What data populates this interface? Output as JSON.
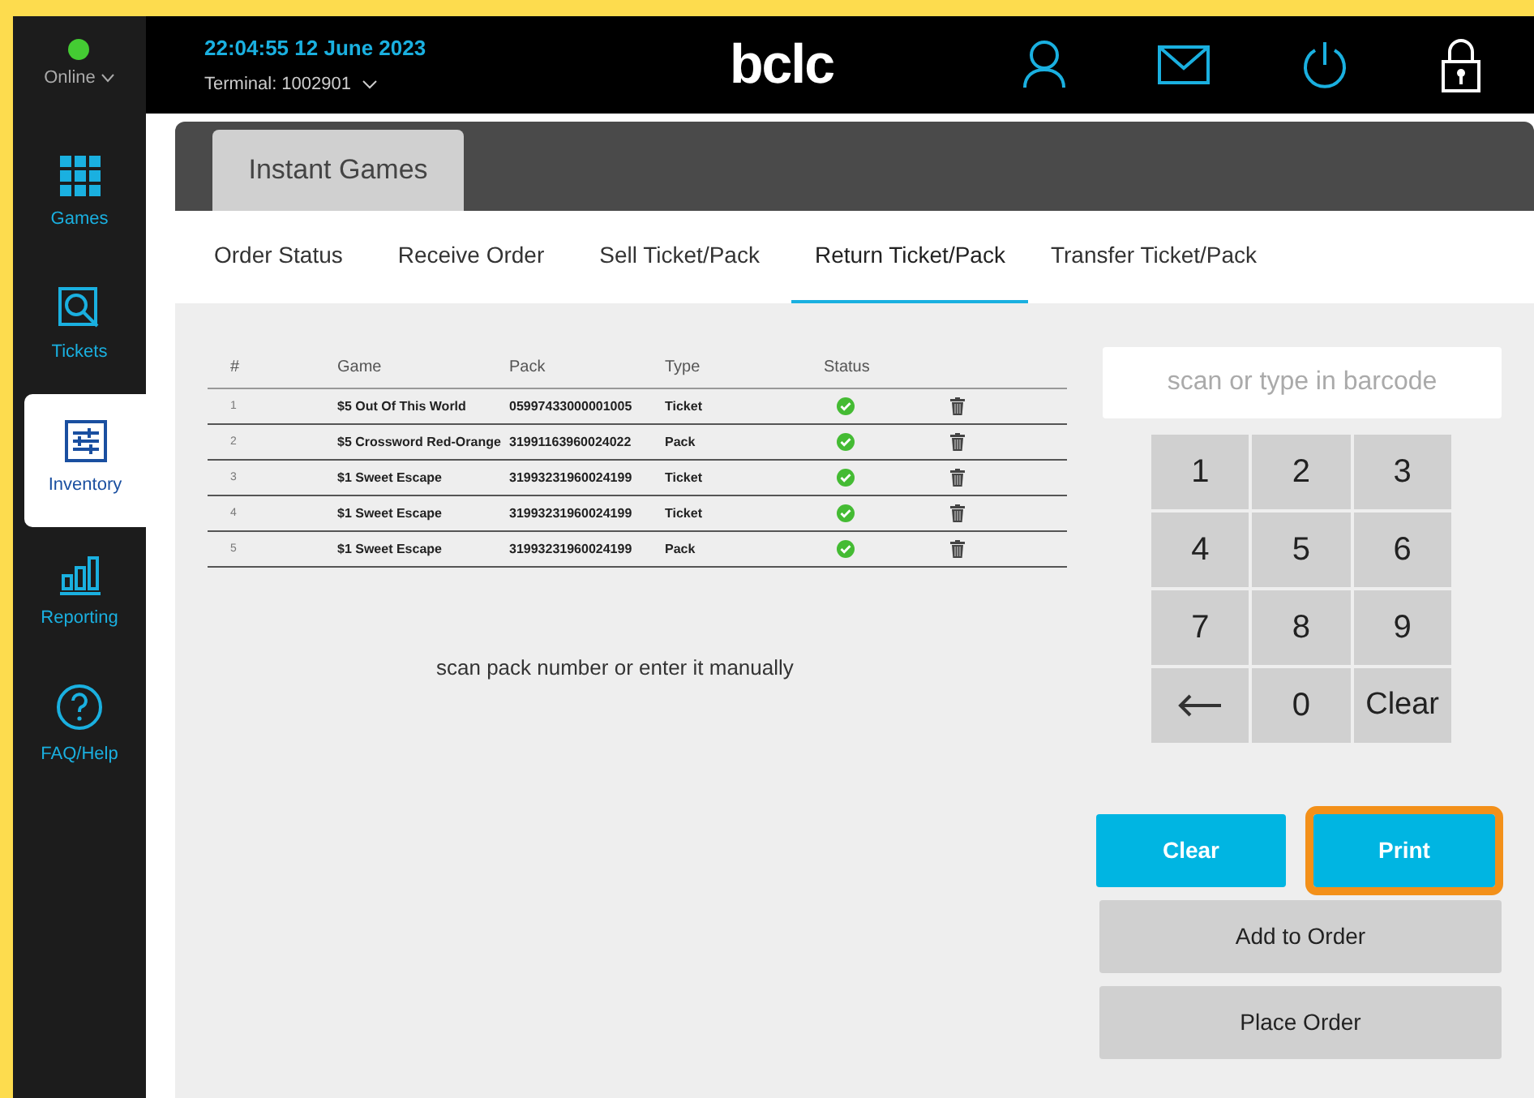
{
  "status": {
    "label": "Online",
    "online": true
  },
  "header": {
    "datetime": "22:04:55  12 June 2023",
    "terminal": "Terminal: 1002901",
    "logo": "bclc"
  },
  "sidebar": {
    "items": [
      {
        "label": "Games",
        "selected": false
      },
      {
        "label": "Tickets",
        "selected": false
      },
      {
        "label": "Inventory",
        "selected": true
      },
      {
        "label": "Reporting",
        "selected": false
      },
      {
        "label": "FAQ/Help",
        "selected": false
      }
    ]
  },
  "section_tab": {
    "label": "Instant Games"
  },
  "tabs": [
    {
      "label": "Order Status",
      "selected": false
    },
    {
      "label": "Receive Order",
      "selected": false
    },
    {
      "label": "Sell Ticket/Pack",
      "selected": false
    },
    {
      "label": "Return Ticket/Pack",
      "selected": true
    },
    {
      "label": "Transfer Ticket/Pack",
      "selected": false
    }
  ],
  "table": {
    "columns": [
      "#",
      "Game",
      "Pack",
      "Type",
      "Status"
    ],
    "rows": [
      {
        "index": "1",
        "game": "$5 Out Of This World",
        "pack": "05997433000001005",
        "type": "Ticket",
        "status_ok": true
      },
      {
        "index": "2",
        "game": "$5 Crossword Red-Orange",
        "pack": "31991163960024022",
        "type": "Pack",
        "status_ok": true
      },
      {
        "index": "3",
        "game": "$1 Sweet Escape",
        "pack": "31993231960024199",
        "type": "Ticket",
        "status_ok": true
      },
      {
        "index": "4",
        "game": "$1 Sweet Escape",
        "pack": "31993231960024199",
        "type": "Ticket",
        "status_ok": true
      },
      {
        "index": "5",
        "game": "$1 Sweet Escape",
        "pack": "31993231960024199",
        "type": "Pack",
        "status_ok": true
      }
    ]
  },
  "hint": "scan pack number or enter it manually",
  "barcode": {
    "placeholder": "scan or type in barcode"
  },
  "keypad": [
    {
      "kind": "key",
      "label": "1"
    },
    {
      "kind": "key",
      "label": "2"
    },
    {
      "kind": "key",
      "label": "3"
    },
    {
      "kind": "key",
      "label": "4"
    },
    {
      "kind": "key",
      "label": "5"
    },
    {
      "kind": "key",
      "label": "6"
    },
    {
      "kind": "key",
      "label": "7"
    },
    {
      "kind": "key",
      "label": "8"
    },
    {
      "kind": "key",
      "label": "9"
    },
    {
      "kind": "backspace"
    },
    {
      "kind": "key",
      "label": "0"
    },
    {
      "kind": "key",
      "label": "Clear"
    }
  ],
  "actions": [
    {
      "kind": "primary",
      "label": "Clear",
      "highlighted": false
    },
    {
      "kind": "primary",
      "label": "Print",
      "highlighted": true
    },
    {
      "kind": "secondary",
      "label": "Add to Order",
      "highlighted": false
    },
    {
      "kind": "secondary",
      "label": "Place Order",
      "highlighted": false
    }
  ]
}
